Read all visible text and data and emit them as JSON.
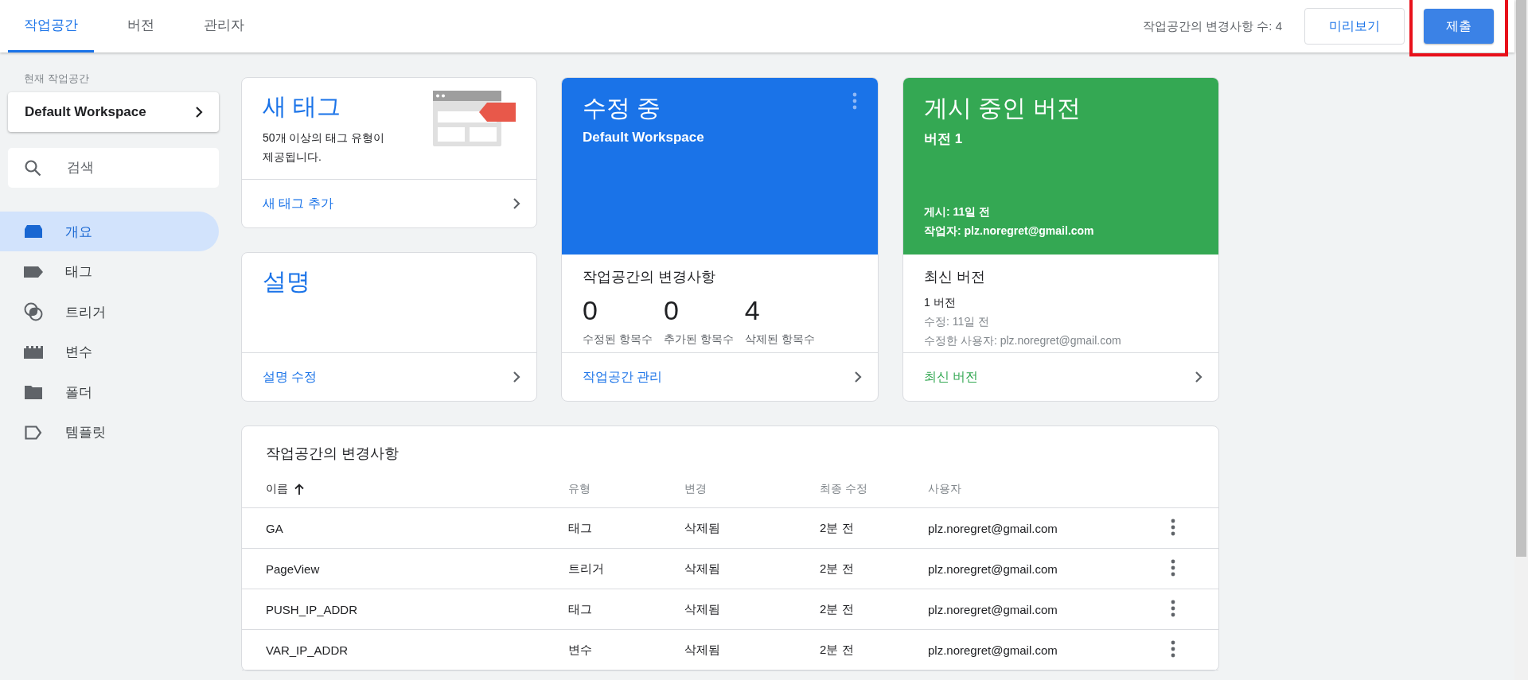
{
  "tabs": [
    {
      "label": "작업공간",
      "selected": true
    },
    {
      "label": "버전",
      "selected": false
    },
    {
      "label": "관리자",
      "selected": false
    }
  ],
  "header": {
    "change_count": "작업공간의 변경사항 수: 4",
    "preview_button": "미리보기",
    "submit_button": "제출",
    "submit_highlighted": true
  },
  "sidebar": {
    "workspace_label": "현재 작업공간",
    "workspace": "Default Workspace",
    "search": {
      "placeholder": "검색"
    },
    "items": [
      {
        "label": "개요",
        "kind": "overview",
        "selected": true
      },
      {
        "label": "태그",
        "kind": "tag",
        "selected": false
      },
      {
        "label": "트리거",
        "kind": "trigger",
        "selected": false
      },
      {
        "label": "변수",
        "kind": "variable",
        "selected": false
      },
      {
        "label": "폴더",
        "kind": "folder",
        "selected": false
      },
      {
        "label": "템플릿",
        "kind": "template",
        "selected": false
      }
    ]
  },
  "new_tag_card": {
    "title": "새 태그",
    "description": "50개 이상의 태그 유형이 제공됩니다.",
    "link": "새 태그 추가"
  },
  "description_card": {
    "title": "설명",
    "link": "설명 수정"
  },
  "editing_card": {
    "title": "수정 중",
    "subtitle": "Default Workspace",
    "section_title": "작업공간의 변경사항",
    "stats": [
      {
        "value": "0",
        "label": "수정된 항목수"
      },
      {
        "value": "0",
        "label": "추가된 항목수"
      },
      {
        "value": "4",
        "label": "삭제된 항목수"
      }
    ],
    "link": "작업공간 관리"
  },
  "published_card": {
    "title": "게시 중인 버전",
    "subtitle": "버전 1",
    "published": "게시: 11일 전",
    "author": "작업자: plz.noregret@gmail.com",
    "section_title": "최신 버전",
    "version": "1 버전",
    "modified": "수정: 11일 전",
    "modified_by": "수정한 사용자: plz.noregret@gmail.com",
    "link": "최신 버전"
  },
  "changes_table": {
    "title": "작업공간의 변경사항",
    "columns": [
      {
        "label": "이름",
        "sorted": true
      },
      {
        "label": "유형",
        "sorted": false
      },
      {
        "label": "변경",
        "sorted": false
      },
      {
        "label": "최종 수정",
        "sorted": false
      },
      {
        "label": "사용자",
        "sorted": false
      }
    ],
    "rows": [
      {
        "name": "GA",
        "type": "태그",
        "change": "삭제됨",
        "modified": "2분 전",
        "user": "plz.noregret@gmail.com"
      },
      {
        "name": "PageView",
        "type": "트리거",
        "change": "삭제됨",
        "modified": "2분 전",
        "user": "plz.noregret@gmail.com"
      },
      {
        "name": "PUSH_IP_ADDR",
        "type": "태그",
        "change": "삭제됨",
        "modified": "2분 전",
        "user": "plz.noregret@gmail.com"
      },
      {
        "name": "VAR_IP_ADDR",
        "type": "변수",
        "change": "삭제됨",
        "modified": "2분 전",
        "user": "plz.noregret@gmail.com"
      }
    ]
  }
}
